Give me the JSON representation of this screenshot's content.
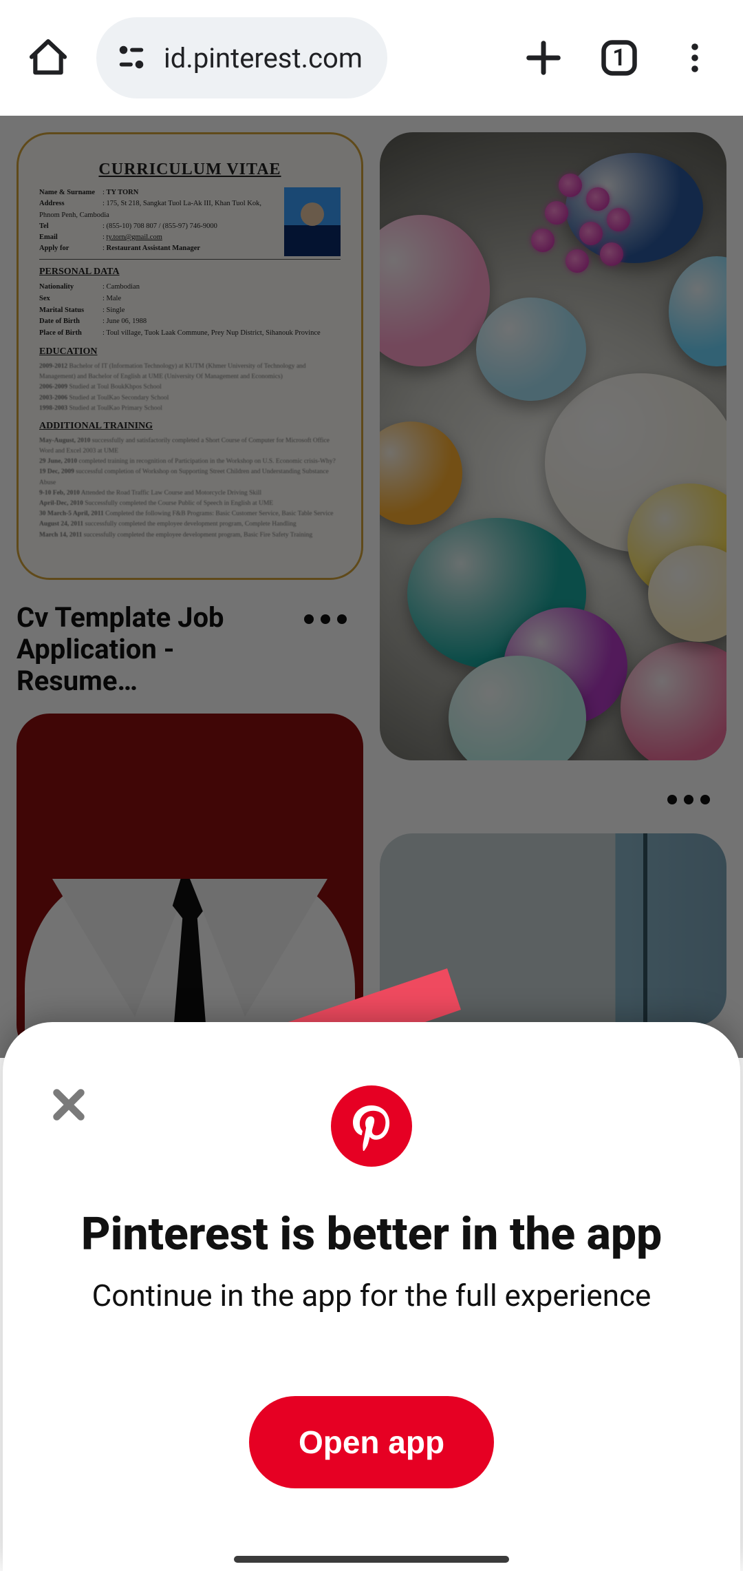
{
  "browser": {
    "url": "id.pinterest.com",
    "tab_count": "1"
  },
  "feed": {
    "pins": {
      "cv": {
        "title": "Cv Template Job Application - Resume…",
        "doc": {
          "heading": "CURRICULUM VITAE",
          "name_label": "Name & Surname",
          "name": "TY TORN",
          "address_label": "Address",
          "address": "175, St 218, Sangkat Tuol La-Ak III, Khan Tuol Kok, Phnom Penh, Cambodia",
          "tel_label": "Tel",
          "tel": "(855-10) 708 807 / (855-97) 746-9000",
          "email_label": "Email",
          "email": "ty.torn@gmail.com",
          "apply_label": "Apply for",
          "apply": "Restaurant Assistant Manager",
          "sec_personal": "PERSONAL DATA",
          "nat_label": "Nationality",
          "nat": "Cambodian",
          "sex_label": "Sex",
          "sex": "Male",
          "ms_label": "Marital Status",
          "ms": "Single",
          "dob_label": "Date of Birth",
          "dob": "June 06, 1988",
          "pob_label": "Place of Birth",
          "pob": "Toul village, Tuok Laak Commune, Prey Nup District, Sihanouk Province",
          "sec_edu": "EDUCATION",
          "sec_train": "ADDITIONAL TRAINING"
        }
      }
    }
  },
  "sheet": {
    "title": "Pinterest is better in the app",
    "subtitle": "Continue in the app for the full experience",
    "cta": "Open app"
  }
}
